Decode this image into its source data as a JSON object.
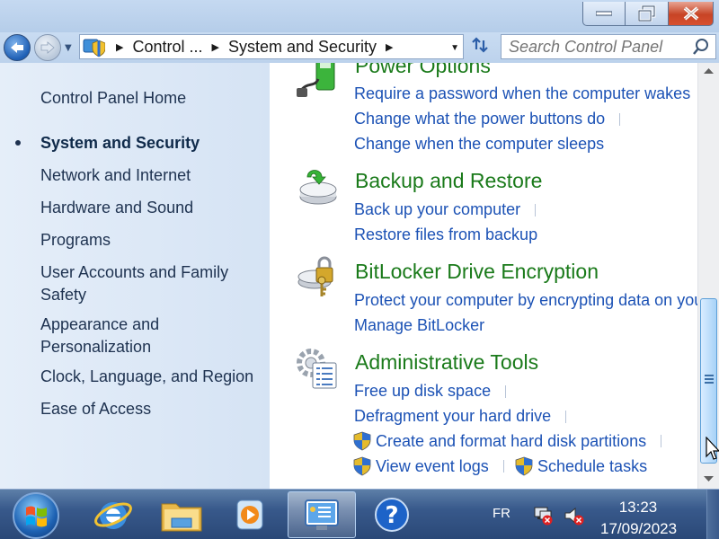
{
  "window": {
    "title_buttons": {
      "minimize": "minimize",
      "maximize": "restore",
      "close": "close"
    }
  },
  "address_bar": {
    "crumbs": [
      "Control ...",
      "System and Security"
    ],
    "icon": "control-panel-icon"
  },
  "search": {
    "placeholder": "Search Control Panel"
  },
  "left_nav": {
    "home": "Control Panel Home",
    "items": [
      {
        "label": "System and Security",
        "active": true
      },
      {
        "label": "Network and Internet"
      },
      {
        "label": "Hardware and Sound"
      },
      {
        "label": "Programs"
      },
      {
        "label": "User Accounts and Family Safety"
      },
      {
        "label": "Appearance and Personalization"
      },
      {
        "label": "Clock, Language, and Region"
      },
      {
        "label": "Ease of Access"
      }
    ]
  },
  "categories": [
    {
      "title": "Power Options",
      "icon": "power-options-icon",
      "tasks": [
        "Require a password when the computer wakes",
        "Change what the power buttons do",
        "Change when the computer sleeps"
      ]
    },
    {
      "title": "Backup and Restore",
      "icon": "backup-restore-icon",
      "tasks": [
        "Back up your computer",
        "Restore files from backup"
      ]
    },
    {
      "title": "BitLocker Drive Encryption",
      "icon": "bitlocker-icon",
      "tasks": [
        "Protect your computer by encrypting data on your disk",
        "Manage BitLocker"
      ]
    },
    {
      "title": "Administrative Tools",
      "icon": "administrative-tools-icon",
      "tasks": [
        "Free up disk space",
        "Defragment your hard drive",
        "Create and format hard disk partitions",
        "View event logs",
        "Schedule tasks"
      ]
    }
  ],
  "taskbar": {
    "language": "FR",
    "time": "13:23",
    "date": "17/09/2023",
    "pinned": [
      "internet-explorer",
      "windows-explorer",
      "media-player",
      "control-panel",
      "help-and-support"
    ]
  },
  "colors": {
    "category_title": "#1a7a1a",
    "task_link": "#1c52b5",
    "left_pane_bg": "#e5eef9"
  }
}
